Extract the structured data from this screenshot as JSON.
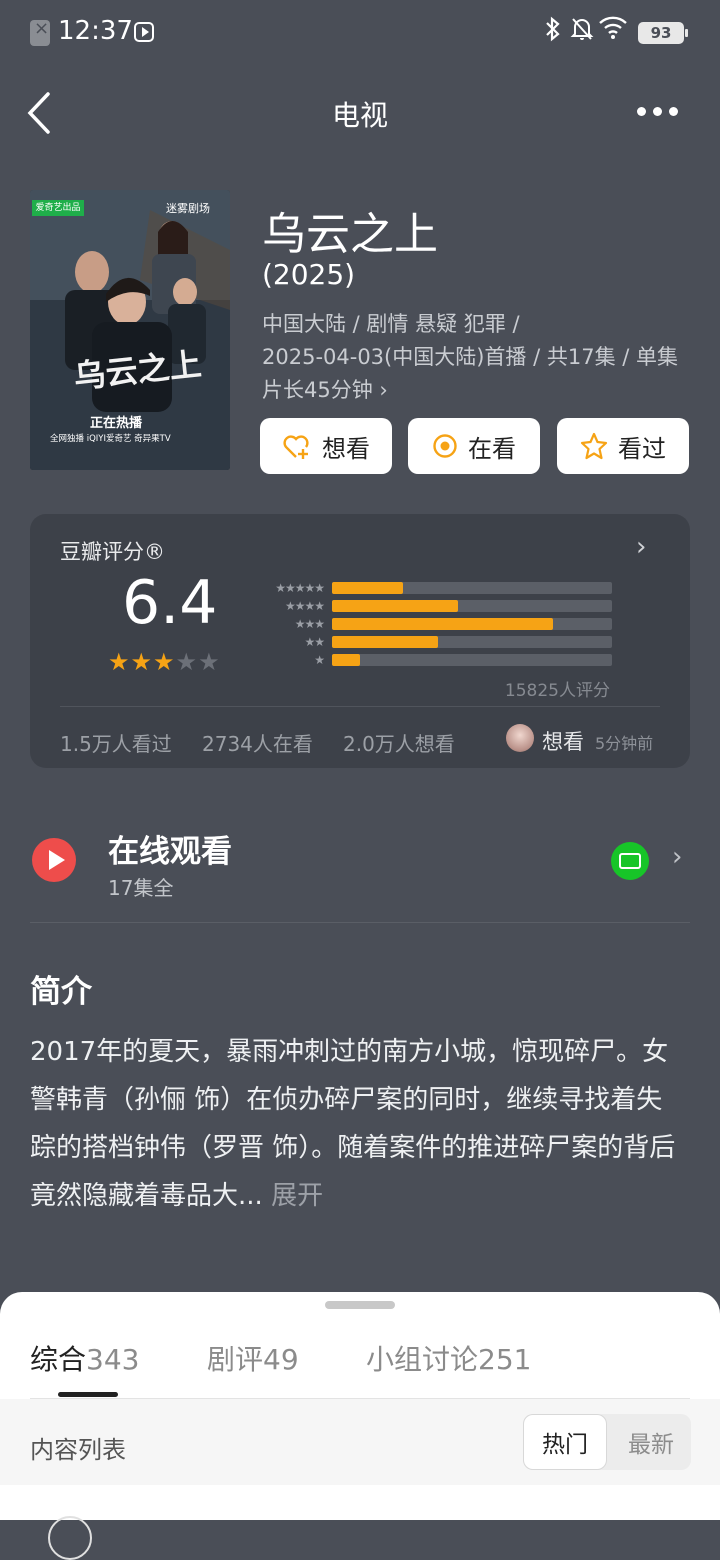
{
  "status_bar": {
    "time": "12:37",
    "battery": "93",
    "icons": [
      "sim-off-icon",
      "media-play-icon",
      "bluetooth-icon",
      "mute-bell-icon",
      "wifi-icon",
      "battery-icon"
    ]
  },
  "nav": {
    "title": "电视",
    "back_icon": "chevron-left-icon",
    "more_icon": "more-dots-icon"
  },
  "poster": {
    "badge_left": "爱奇艺出品",
    "badge_right": "迷雾剧场",
    "calligraphy_title": "乌云之上",
    "now_playing": "正在热播",
    "platforms": "全网独播 iQIYI爱奇艺 奇异果TV"
  },
  "show": {
    "title": "乌云之上",
    "year": "(2025)",
    "meta_line1": "中国大陆 / 剧情 悬疑 犯罪 /",
    "meta_line2": "2025-04-03(中国大陆)首播 / 共17集 / 单集",
    "meta_line3": "片长45分钟",
    "meta_more": "›"
  },
  "actions": {
    "want": "想看",
    "watching": "在看",
    "watched": "看过"
  },
  "rating": {
    "label": "豆瓣评分®",
    "score": "6.4",
    "stars_filled": 3,
    "stars_total": 5,
    "distribution": [
      {
        "stars": "★★★★★",
        "percent": 12.7
      },
      {
        "stars": "★★★★",
        "percent": 22.5
      },
      {
        "stars": "★★★",
        "percent": 39.4
      },
      {
        "stars": "★★",
        "percent": 19.0
      },
      {
        "stars": "★",
        "percent": 5.0
      }
    ],
    "count": "15825人评分",
    "seen": "1.5万人看过",
    "watching": "2734人在看",
    "want": "2.0万人想看",
    "friend_action": "想看",
    "friend_time": "5分钟前",
    "accent_color": "#f6a315"
  },
  "online": {
    "title": "在线观看",
    "subtitle": "17集全",
    "platform_icon": "iqiyi-logo-icon",
    "icon_color": "#ee4d4b"
  },
  "intro": {
    "heading": "简介",
    "text": "2017年的夏天，暴雨冲刺过的南方小城，惊现碎尸。女警韩青（孙俪 饰）在侦办碎尸案的同时，继续寻找着失踪的搭档钟伟（罗晋 饰）。随着案件的推进碎尸案的背后竟然隐藏着毒品大...",
    "expand": "展开"
  },
  "sheet": {
    "tabs": [
      {
        "label": "综合",
        "count": "343"
      },
      {
        "label": "剧评",
        "count": "49"
      },
      {
        "label": "小组讨论",
        "count": "251"
      }
    ],
    "list_label": "内容列表",
    "sort_hot": "热门",
    "sort_new": "最新"
  }
}
